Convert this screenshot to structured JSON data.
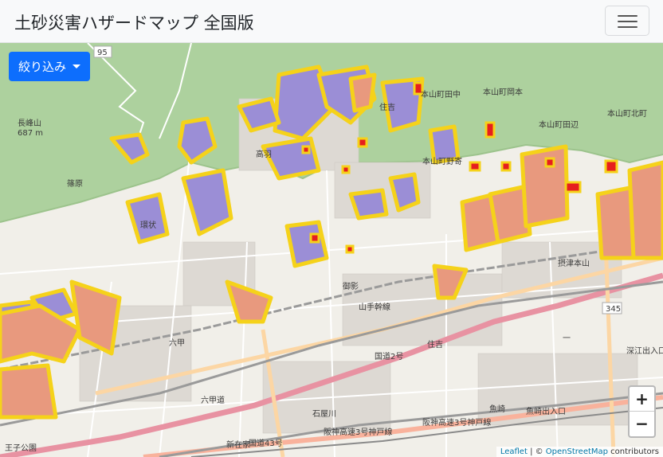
{
  "navbar": {
    "title": "土砂災害ハザードマップ 全国版",
    "menu_icon": "hamburger-icon"
  },
  "map": {
    "filter_button": {
      "label": "絞り込み",
      "icon": "caret-down-icon"
    },
    "zoom_in": "+",
    "zoom_out": "−",
    "attribution": {
      "leaflet": "Leaflet",
      "separator": " | © ",
      "osm": "OpenStreetMap",
      "suffix": " contributors"
    },
    "labels": {
      "l95": "95",
      "mountain": "長峰山",
      "mountain_alt": "687 m",
      "takaha": "高羽",
      "shinohara": "篠原",
      "sumiyoshi": "住吉",
      "honyama_tanaka": "本山町田中",
      "honyama_okamoto": "本山町岡本",
      "honyama_taniguchi": "本山町田辺",
      "honyama_kitamachi": "本山町北町",
      "honyama_noyori": "本山町野寄",
      "rokko": "六甲",
      "route2": "国道2号",
      "route43": "国道43号",
      "mikage": "御影",
      "uozaki": "魚崎",
      "ishiyagawa": "石屋川",
      "sanyo_shinkansen": "山手幹線",
      "settsu_honyama": "摂津本山",
      "oji_park": "王子公園",
      "shinzaike": "新在家",
      "fukae": "深江出入口",
      "rokkomichi": "六甲道",
      "r345": "345",
      "sumiyoshi2": "住吉",
      "uozaki_exit": "魚崎出入口",
      "hanshin": "阪神高速3号神戸線",
      "hanshin2": "阪神高速3号神戸線",
      "ichi": "一",
      "kanjo": "環状"
    }
  },
  "colors": {
    "forest": "#add19e",
    "urban": "#f1efe9",
    "hazard_yellow": "#f5d21a",
    "hazard_purple": "#9b8ed6",
    "hazard_red": "#e61e1e",
    "hazard_orange": "#e8997e",
    "primary": "#0d6efd",
    "road_major": "#e892a2",
    "road_trunk": "#f9b29c",
    "rail": "#9a9a9a"
  }
}
